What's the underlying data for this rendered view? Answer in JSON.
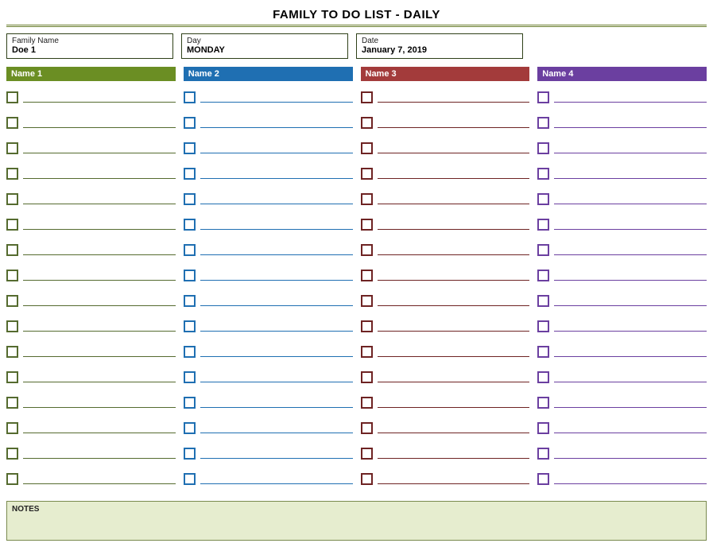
{
  "title": "FAMILY TO DO LIST - DAILY",
  "info": {
    "family_name_label": "Family Name",
    "family_name_value": "Doe 1",
    "day_label": "Day",
    "day_value": "MONDAY",
    "date_label": "Date",
    "date_value": "January 7, 2019"
  },
  "columns": [
    {
      "header": "Name 1",
      "color": "green"
    },
    {
      "header": "Name 2",
      "color": "blue"
    },
    {
      "header": "Name 3",
      "color": "red"
    },
    {
      "header": "Name 4",
      "color": "purple"
    }
  ],
  "rows_per_column": 16,
  "notes_label": "NOTES"
}
